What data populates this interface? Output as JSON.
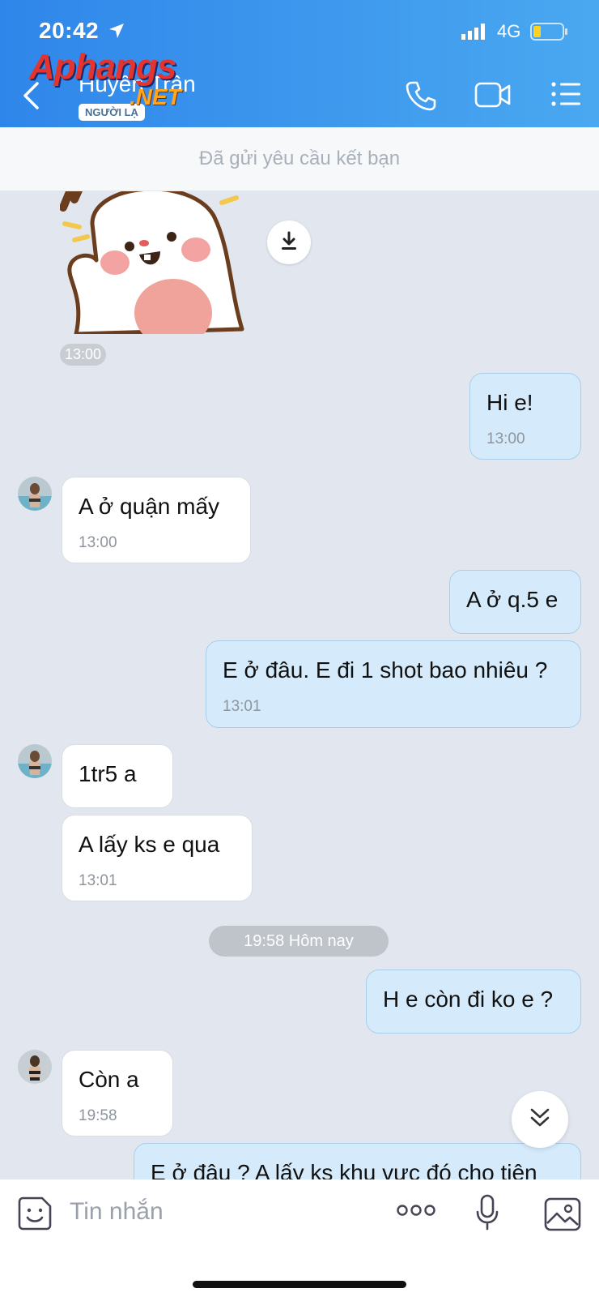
{
  "status_bar": {
    "time": "20:42",
    "network": "4G"
  },
  "watermark": {
    "main": "Aphangs",
    "suffix": ".NET"
  },
  "header": {
    "contact_name": "Huyền Trân",
    "badge": "NGƯỜI LẠ"
  },
  "banner": {
    "text": "Đã gửi yêu cầu kết bạn"
  },
  "sticker": {
    "time": "13:00"
  },
  "messages": [
    {
      "dir": "out",
      "text": "Hi e!",
      "time": "13:00"
    },
    {
      "dir": "in",
      "text": "A ở quận mấy",
      "time": "13:00"
    },
    {
      "dir": "out",
      "text": "A ở q.5 e"
    },
    {
      "dir": "out",
      "text": "E ở đâu. E đi 1 shot bao nhiêu ?",
      "time": "13:01"
    },
    {
      "dir": "in",
      "text": "1tr5 a"
    },
    {
      "dir": "in",
      "text": "A lấy ks e qua",
      "time": "13:01"
    },
    {
      "dir": "out",
      "text": "H e còn đi ko e ?"
    },
    {
      "dir": "in",
      "text": "Còn a",
      "time": "19:58"
    },
    {
      "dir": "out",
      "text": "E ở đâu ? A lấy ks khu vực đó cho tiện"
    }
  ],
  "day_divider": "19:58 Hôm nay",
  "input": {
    "placeholder": "Tin nhắn"
  },
  "colors": {
    "header_start": "#2f86ea",
    "header_end": "#4aa8f0",
    "bubble_out": "#d5ebfb",
    "bubble_in": "#ffffff",
    "background": "#e2e7ef"
  },
  "icons": [
    "back-icon",
    "call-icon",
    "video-icon",
    "menu-icon",
    "download-icon",
    "scroll-down-icon",
    "sticker-icon",
    "more-icon",
    "mic-icon",
    "image-icon"
  ]
}
